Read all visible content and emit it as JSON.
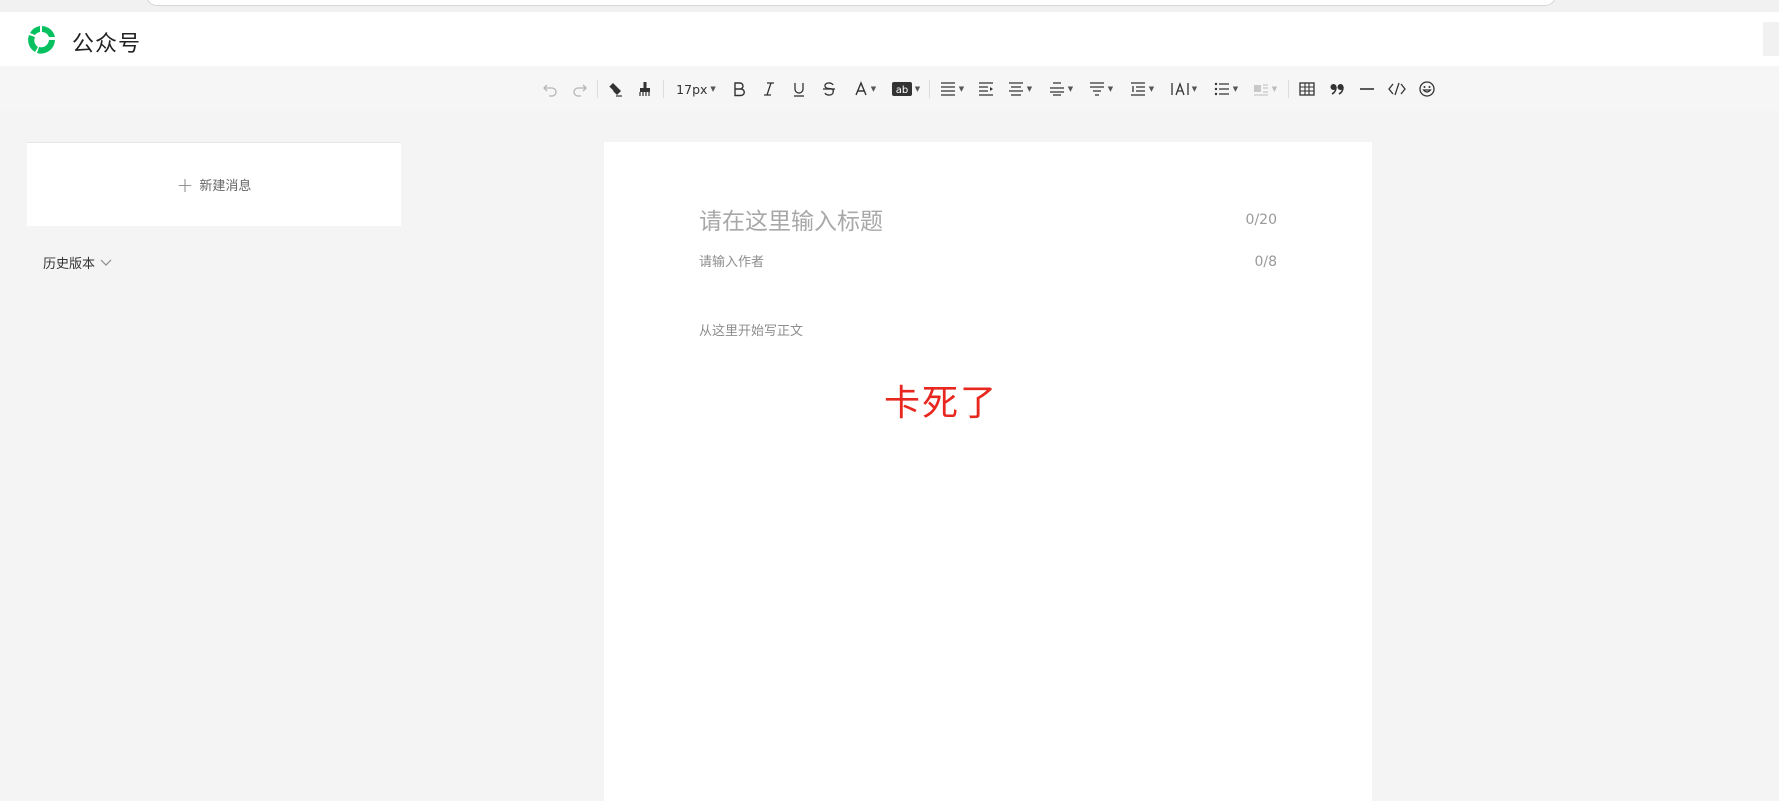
{
  "header": {
    "brand": "公众号",
    "logo_icon": "wechat-official-account-logo"
  },
  "toolbar": {
    "font_size": "17px",
    "buttons": [
      "undo-icon",
      "redo-icon",
      "eraser-icon",
      "format-painter-icon",
      "font-size",
      "bold-icon",
      "italic-icon",
      "underline-icon",
      "strikethrough-icon",
      "font-color-icon",
      "background-color-icon",
      "align-icon",
      "indent-icon",
      "align-center-icon",
      "paragraph-spacing-before-icon",
      "paragraph-spacing-after-icon",
      "line-height-icon",
      "letter-spacing-icon",
      "list-icon",
      "float-icon",
      "table-icon",
      "quote-icon",
      "horizontal-rule-icon",
      "code-icon",
      "emoji-icon"
    ]
  },
  "sidebar": {
    "new_message": "新建消息",
    "history": "历史版本"
  },
  "editor": {
    "title_placeholder": "请在这里输入标题",
    "title_count": "0/20",
    "author_placeholder": "请输入作者",
    "author_count": "0/8",
    "body_placeholder": "从这里开始写正文",
    "overlay_text": "卡死了"
  },
  "colors": {
    "brand_green": "#07c160",
    "overlay_red": "#e8271f"
  }
}
